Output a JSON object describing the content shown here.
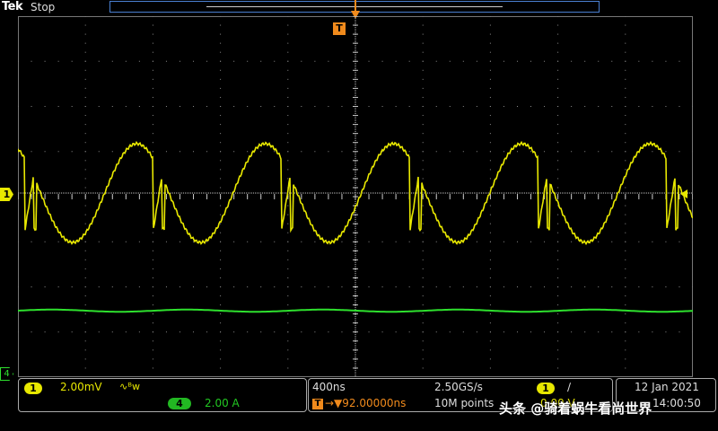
{
  "header": {
    "brand": "Tek",
    "state": "Stop"
  },
  "trigger": {
    "marker": "T",
    "icon": "trigger-position-arrow-icon"
  },
  "channels": {
    "ch1_marker": "1",
    "ch4_marker": "4"
  },
  "readout": {
    "ch1_badge": "1",
    "ch1_scale": "2.00mV",
    "bandwidth_glyph": "∿ᴮw",
    "ch4_badge": "4",
    "ch4_scale": "2.00 A",
    "time_per_div": "400ns",
    "sample_rate": "2.50GS/s",
    "trigger_badge": "T",
    "trigger_offset": "→▼92.00000ns",
    "record_length": "10M points",
    "trigger_source_badge": "1",
    "trigger_slope": "∕",
    "trigger_level": "0.00 V",
    "date": "12 Jan  2021",
    "time": "14:00:50"
  },
  "watermark": "头条 @骑着蜗牛看尚世界",
  "colors": {
    "ch1": "#e8e800",
    "ch4": "#2ee02e",
    "trigger": "#f08a1c",
    "grid": "#8a8a8a"
  }
}
